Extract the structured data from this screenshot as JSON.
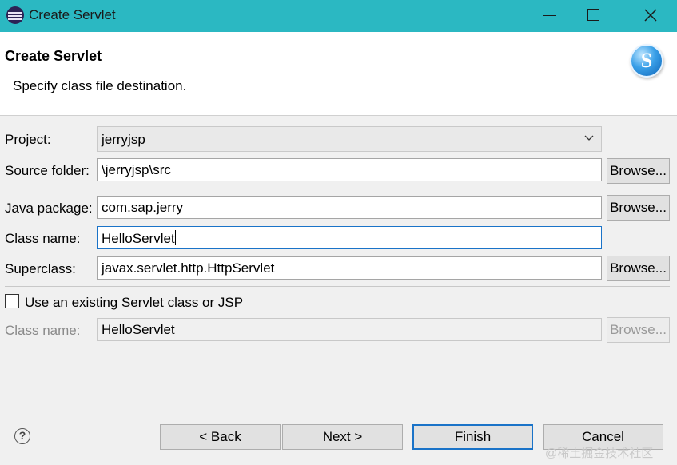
{
  "window": {
    "title": "Create Servlet",
    "title_bar_color": "#2bb8c2"
  },
  "header": {
    "title": "Create Servlet",
    "message": "Specify class file destination.",
    "logo_letter": "S"
  },
  "form": {
    "project": {
      "label": "Project:",
      "value": "jerryjsp"
    },
    "source_folder": {
      "label": "Source folder:",
      "value": "\\jerryjsp\\src",
      "browse_label": "Browse..."
    },
    "java_package": {
      "label": "Java package:",
      "value": "com.sap.jerry",
      "browse_label": "Browse..."
    },
    "class_name": {
      "label": "Class name:",
      "value": "HelloServlet"
    },
    "superclass": {
      "label": "Superclass:",
      "value": "javax.servlet.http.HttpServlet",
      "browse_label": "Browse..."
    },
    "use_existing": {
      "label": "Use an existing Servlet class or JSP",
      "checked": false
    },
    "existing_class_name": {
      "label": "Class name:",
      "value": "HelloServlet",
      "browse_label": "Browse..."
    }
  },
  "buttons": {
    "help": "?",
    "back": "< Back",
    "next": "Next >",
    "finish": "Finish",
    "cancel": "Cancel"
  },
  "watermark": "@稀土掘金技术社区",
  "colors": {
    "focus_border": "#1a73c8",
    "disabled_text": "#8a8a8a"
  }
}
